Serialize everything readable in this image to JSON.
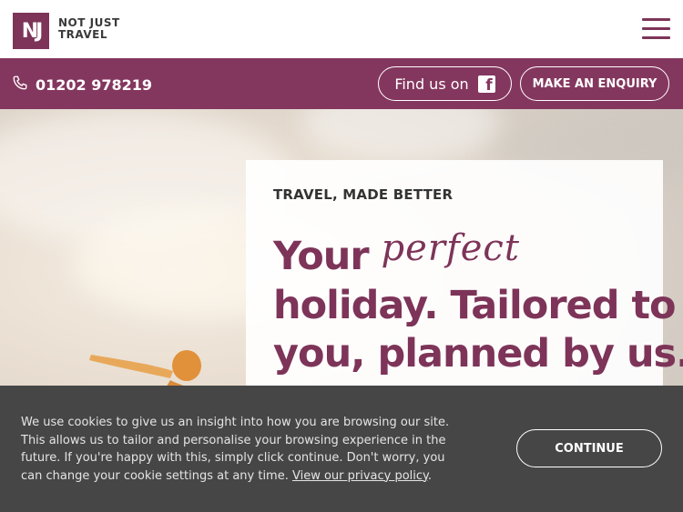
{
  "brand": {
    "logo_mark": "NJ",
    "name_line1": "NOT JUST",
    "name_line2": "TRAVEL",
    "color": "#84375e"
  },
  "header": {
    "menu_icon": "hamburger-menu-icon"
  },
  "contact_bar": {
    "phone_icon": "phone-icon",
    "phone_number": "01202 978219",
    "facebook_label": "Find us on",
    "facebook_icon": "facebook-icon",
    "enquiry_label": "MAKE AN ENQUIRY"
  },
  "hero": {
    "eyebrow": "TRAVEL, MADE BETTER",
    "headline_word1": "Your",
    "headline_script": "perfect",
    "headline_line2": "holiday. Tailored to",
    "headline_line3": "you, planned by us."
  },
  "cookie_banner": {
    "text": "We use cookies to give us an insight into how you are browsing our site. This allows us to tailor and personalise your browsing experience in the future. If you're happy with this, simply click continue. Don't worry, you can change your cookie settings at any time. ",
    "link_text": "View our privacy policy",
    "link_suffix": ".",
    "continue_label": "CONTINUE",
    "background": "#464646"
  }
}
